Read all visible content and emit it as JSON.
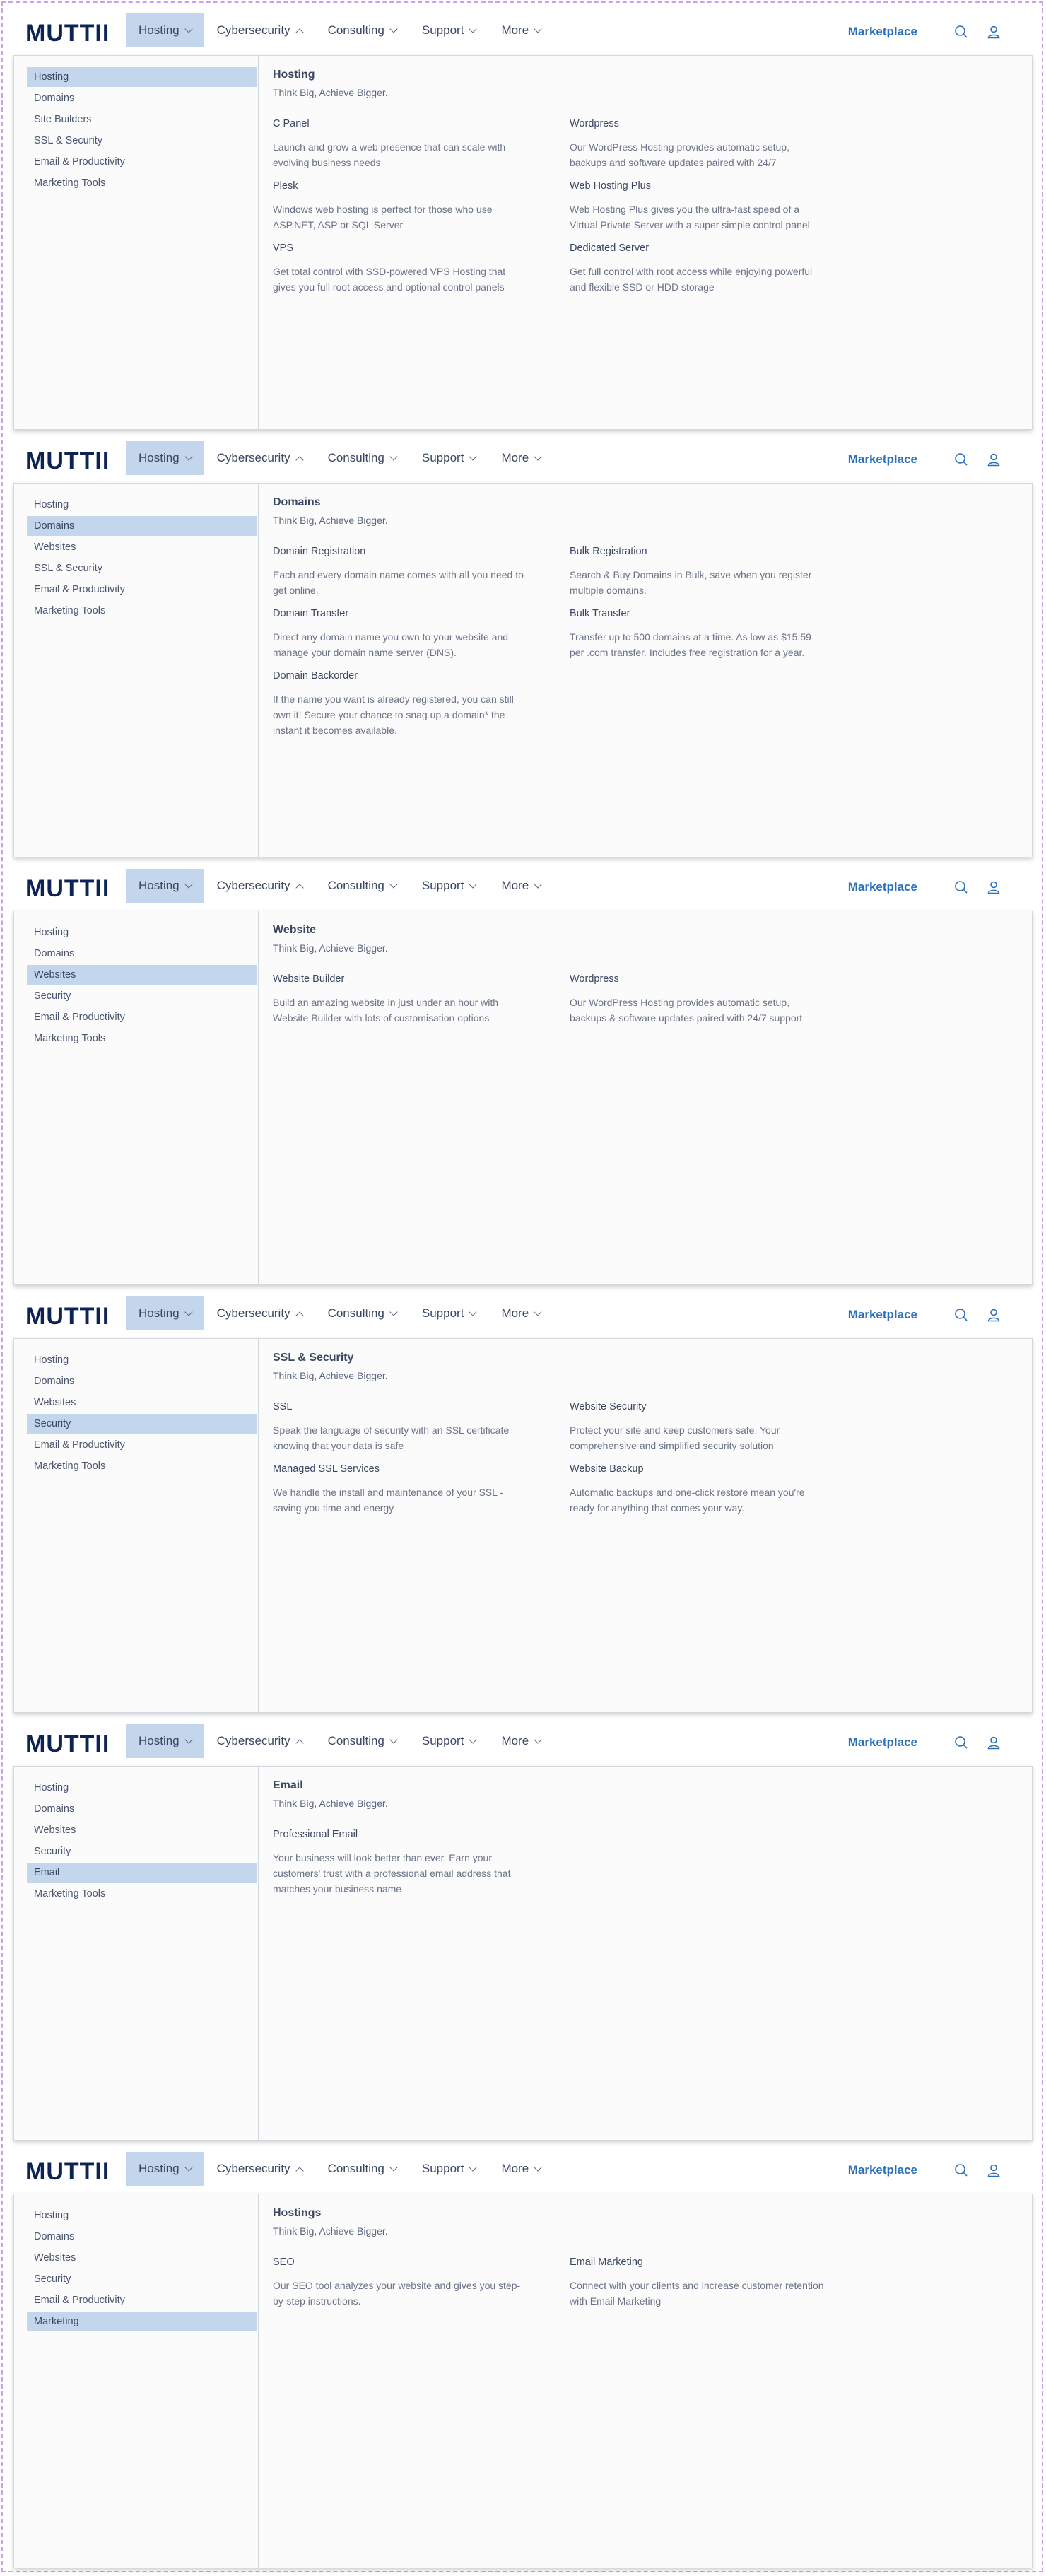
{
  "colors": {
    "accent": "#2a6fb8",
    "selected_bg": "#c3d6ec",
    "text": "#3a4760"
  },
  "nav": {
    "logo": "MUTTII",
    "items": [
      {
        "label": "Hosting",
        "chevron": "down"
      },
      {
        "label": "Cybersecurity",
        "chevron": "up"
      },
      {
        "label": "Consulting",
        "chevron": "down"
      },
      {
        "label": "Support",
        "chevron": "down"
      },
      {
        "label": "More",
        "chevron": "down"
      }
    ],
    "marketplace": "Marketplace",
    "icons": [
      "search-icon",
      "user-icon"
    ]
  },
  "panels": [
    {
      "sidebar": [
        "Hosting",
        "Domains",
        "Site Builders",
        "SSL & Security",
        "Email & Productivity",
        "Marketing Tools"
      ],
      "selected": 0,
      "title": "Hosting",
      "subtitle": "Think Big, Achieve Bigger.",
      "services": [
        {
          "name": "C Panel",
          "desc": "Launch and grow a web presence that can scale with evolving business needs"
        },
        {
          "name": "Wordpress",
          "desc": "Our WordPress Hosting provides automatic setup, backups and software updates paired with 24/7"
        },
        {
          "name": "Plesk",
          "desc": "Windows web hosting is perfect for those who use ASP.NET, ASP or SQL Server"
        },
        {
          "name": "Web Hosting Plus",
          "desc": "Web Hosting Plus gives you the ultra-fast speed of a Virtual Private Server with a super simple control panel"
        },
        {
          "name": "VPS",
          "desc": "Get total control with SSD-powered VPS Hosting that gives you full root access and optional control panels"
        },
        {
          "name": "Dedicated Server",
          "desc": "Get full control with root access while enjoying powerful and flexible SSD or HDD storage"
        }
      ]
    },
    {
      "sidebar": [
        "Hosting",
        "Domains",
        "Websites",
        "SSL & Security",
        "Email & Productivity",
        "Marketing Tools"
      ],
      "selected": 1,
      "title": "Domains",
      "subtitle": "Think Big, Achieve Bigger.",
      "services": [
        {
          "name": "Domain Registration",
          "desc": "Each and every domain name comes with all you need to get online."
        },
        {
          "name": "Bulk Registration",
          "desc": "Search & Buy Domains in Bulk, save when you register multiple domains."
        },
        {
          "name": "Domain Transfer",
          "desc": "Direct any domain name you own to your  website and manage your domain name server (DNS)."
        },
        {
          "name": "Bulk Transfer",
          "desc": "Transfer up to 500 domains at a time. As low as $15.59 per .com transfer. Includes free registration for a year."
        },
        {
          "name": "Domain Backorder",
          "desc": "If the name you want is already registered, you can still own it! Secure your chance to snag up a domain* the instant it becomes available."
        }
      ]
    },
    {
      "sidebar": [
        "Hosting",
        "Domains",
        "Websites",
        "Security",
        "Email & Productivity",
        "Marketing Tools"
      ],
      "selected": 2,
      "title": "Website",
      "subtitle": "Think Big, Achieve Bigger.",
      "services": [
        {
          "name": "Website Builder",
          "desc": "Build an amazing website in just under an hour with Website Builder with lots of customisation options"
        },
        {
          "name": "Wordpress",
          "desc": "Our WordPress Hosting provides automatic setup, backups & software updates paired with 24/7 support"
        }
      ]
    },
    {
      "sidebar": [
        "Hosting",
        "Domains",
        "Websites",
        "Security",
        "Email & Productivity",
        "Marketing Tools"
      ],
      "selected": 3,
      "title": "SSL & Security",
      "subtitle": "Think Big, Achieve Bigger.",
      "services": [
        {
          "name": "SSL",
          "desc": "Speak the language of security with an SSL certificate knowing that your data is safe"
        },
        {
          "name": "Website Security",
          "desc": "Protect your site and keep customers safe. Your comprehensive and simplified security solution"
        },
        {
          "name": "Managed SSL Services",
          "desc": "We handle the install and maintenance of your SSL - saving you time and energy"
        },
        {
          "name": "Website Backup",
          "desc": "Automatic backups and one-click restore mean you're ready for anything that comes your way."
        }
      ]
    },
    {
      "sidebar": [
        "Hosting",
        "Domains",
        "Websites",
        "Security",
        "Email",
        "Marketing Tools"
      ],
      "selected": 4,
      "title": "Email",
      "subtitle": "Think Big, Achieve Bigger.",
      "services": [
        {
          "name": "Professional Email",
          "desc": "Your business will look better than ever. Earn your customers' trust with a professional email address that matches your business name"
        }
      ]
    },
    {
      "sidebar": [
        "Hosting",
        "Domains",
        "Websites",
        "Security",
        "Email & Productivity",
        "Marketing"
      ],
      "selected": 5,
      "title": "Hostings",
      "subtitle": "Think Big, Achieve Bigger.",
      "services": [
        {
          "name": "SEO",
          "desc": "Our SEO tool analyzes your website and gives you step-by-step instructions."
        },
        {
          "name": "Email Marketing",
          "desc": "Connect with your clients and increase customer retention with Email Marketing"
        }
      ]
    }
  ]
}
